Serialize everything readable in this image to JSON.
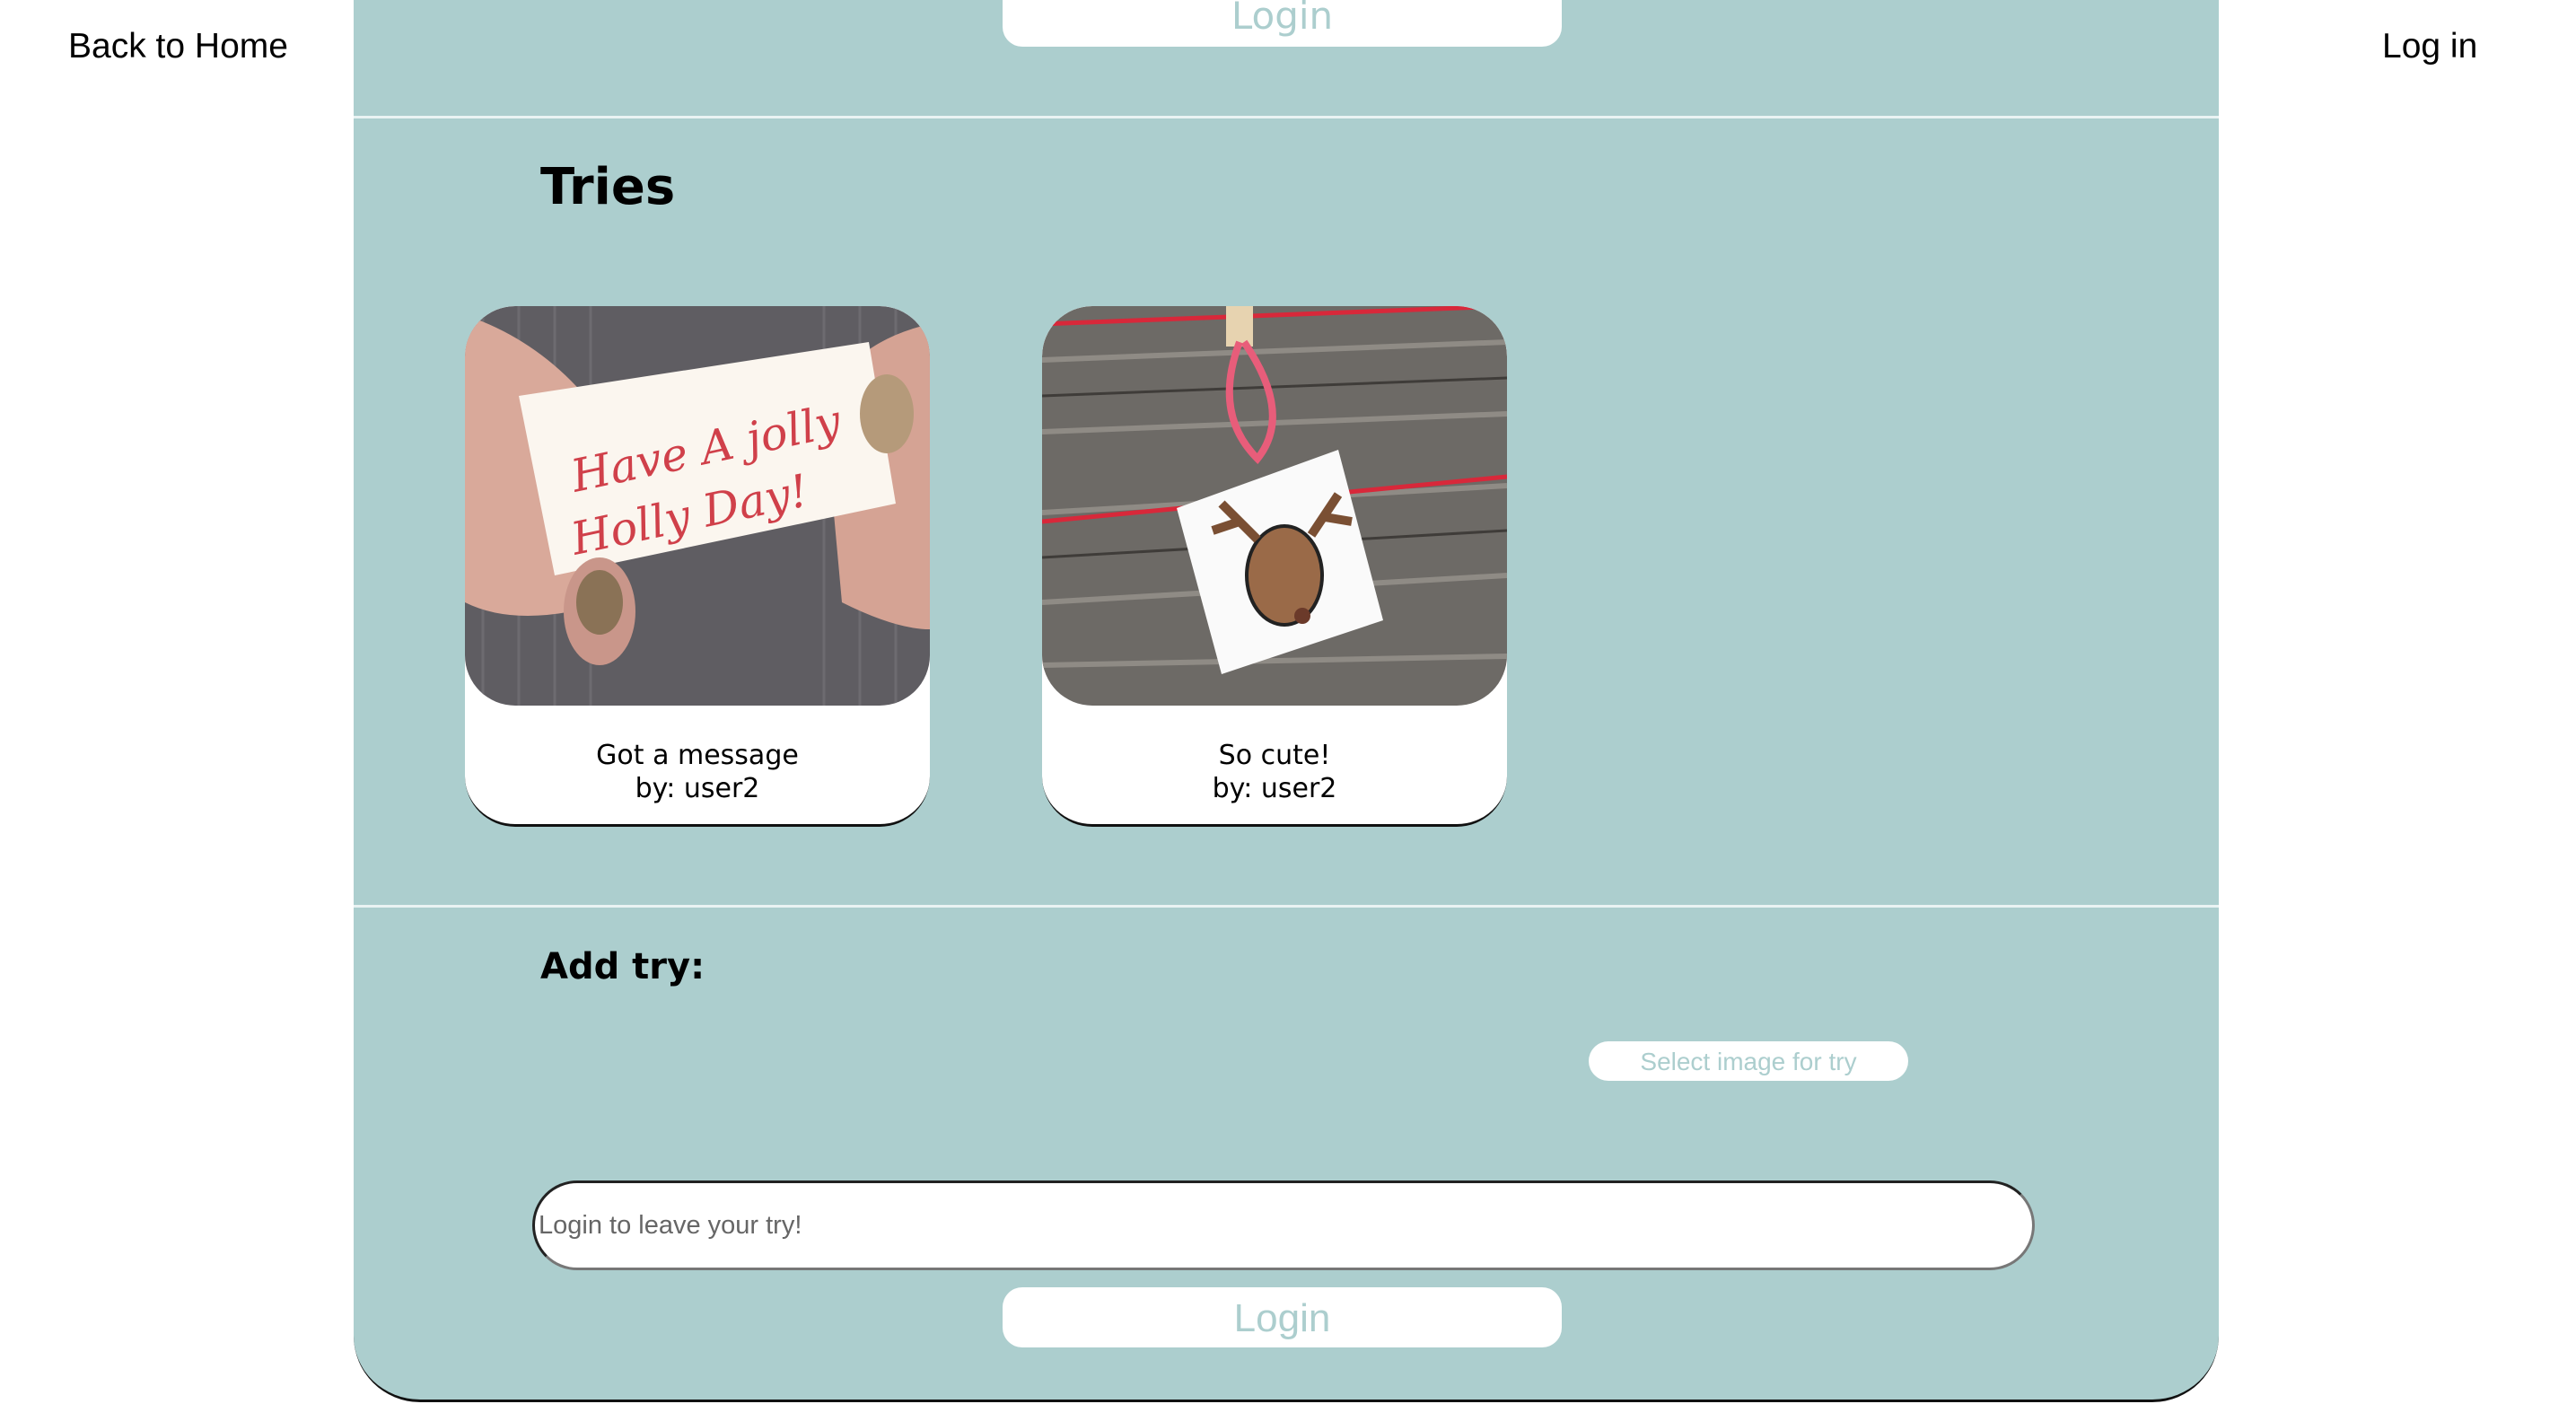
{
  "nav": {
    "back_home": "Back to Home",
    "log_in": "Log in"
  },
  "top_login_button": "Login",
  "tries": {
    "title": "Tries",
    "items": [
      {
        "caption": "Got a message",
        "author": "by: user2",
        "image": "handwritten note 'Have A Holly Jolly Day'"
      },
      {
        "caption": "So cute!",
        "author": "by: user2",
        "image": "reindeer gift box ornament"
      }
    ]
  },
  "add_try": {
    "title": "Add try:",
    "select_image_label": "Select image for try",
    "input_placeholder": "Login to leave your try!",
    "login_button": "Login"
  },
  "colors": {
    "panel": "#accece",
    "button_text": "#accece"
  }
}
